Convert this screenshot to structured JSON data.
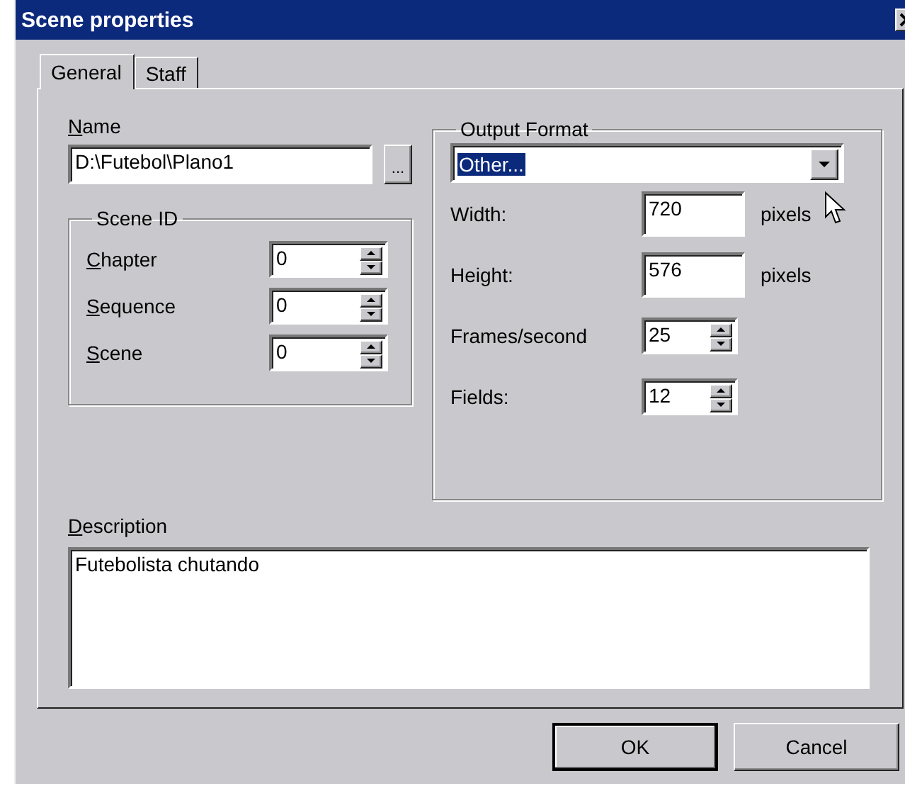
{
  "window": {
    "title": "Scene properties"
  },
  "tabs": [
    {
      "label": "General",
      "selected": true
    },
    {
      "label": "Staff",
      "selected": false
    }
  ],
  "name_field": {
    "label_key": "N",
    "label_rest": "ame",
    "value": "D:\\Futebol\\Plano1",
    "browse_button": "..."
  },
  "scene_id": {
    "title": "Scene ID",
    "fields": [
      {
        "label_key": "C",
        "label_rest": "hapter",
        "value": "0"
      },
      {
        "label_key": "S",
        "label_rest": "equence",
        "value": "0"
      },
      {
        "label_key": "S",
        "label_rest": "cene",
        "value": "0"
      }
    ]
  },
  "output_format": {
    "title": "Output Format",
    "format": "Other...",
    "fields": [
      {
        "kind": "text",
        "label": "Width:",
        "value": "720",
        "unit": "pixels"
      },
      {
        "kind": "text",
        "label": "Height:",
        "value": "576",
        "unit": "pixels"
      },
      {
        "kind": "spin",
        "label": "Frames/second",
        "value": "25"
      },
      {
        "kind": "spin",
        "label": "Fields:",
        "value": "12"
      }
    ]
  },
  "description": {
    "label_key": "D",
    "label_rest": "escription",
    "value": "Futebolista chutando"
  },
  "buttons": [
    {
      "label": "OK",
      "default": true
    },
    {
      "label": "Cancel",
      "default": false
    }
  ]
}
